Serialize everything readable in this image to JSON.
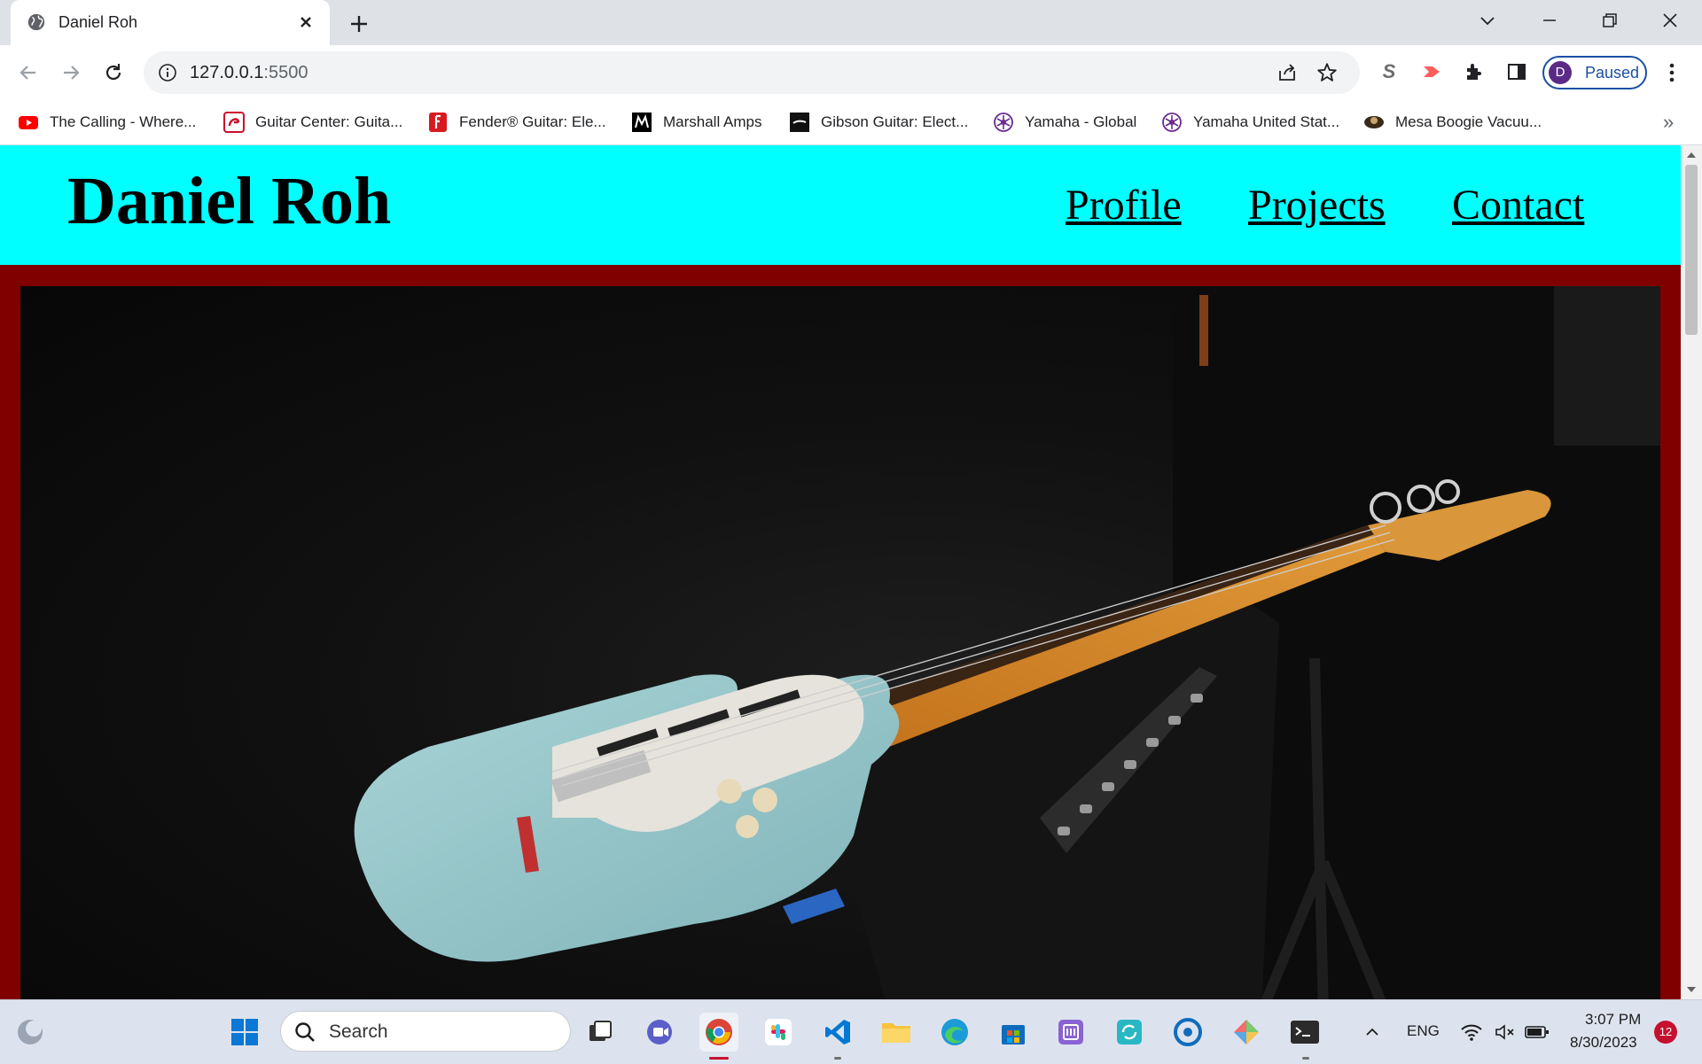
{
  "browser": {
    "tab_title": "Daniel Roh",
    "url_host": "127.0.0.1",
    "url_port": ":5500",
    "profile_initial": "D",
    "profile_status": "Paused"
  },
  "bookmarks": [
    {
      "label": "The Calling - Where...",
      "icon": "youtube-icon",
      "color": "#ff0000"
    },
    {
      "label": "Guitar Center: Guita...",
      "icon": "guitar-center-icon",
      "color": "#c8102e"
    },
    {
      "label": "Fender® Guitar: Ele...",
      "icon": "fender-icon",
      "color": "#d71920"
    },
    {
      "label": "Marshall Amps",
      "icon": "marshall-icon",
      "color": "#000000"
    },
    {
      "label": "Gibson Guitar: Elect...",
      "icon": "gibson-icon",
      "color": "#111111"
    },
    {
      "label": "Yamaha - Global",
      "icon": "yamaha-icon",
      "color": "#6a2c91"
    },
    {
      "label": "Yamaha United Stat...",
      "icon": "yamaha-icon",
      "color": "#6a2c91"
    },
    {
      "label": "Mesa Boogie Vacuu...",
      "icon": "mesa-boogie-icon",
      "color": "#3a2a1a"
    }
  ],
  "site": {
    "title": "Daniel Roh",
    "nav": [
      "Profile",
      "Projects",
      "Contact"
    ],
    "header_color": "#00ffff",
    "page_bg_color": "#800000"
  },
  "taskbar": {
    "search_placeholder": "Search",
    "language": "ENG",
    "time": "3:07 PM",
    "date": "8/30/2023",
    "notification_count": "12"
  }
}
